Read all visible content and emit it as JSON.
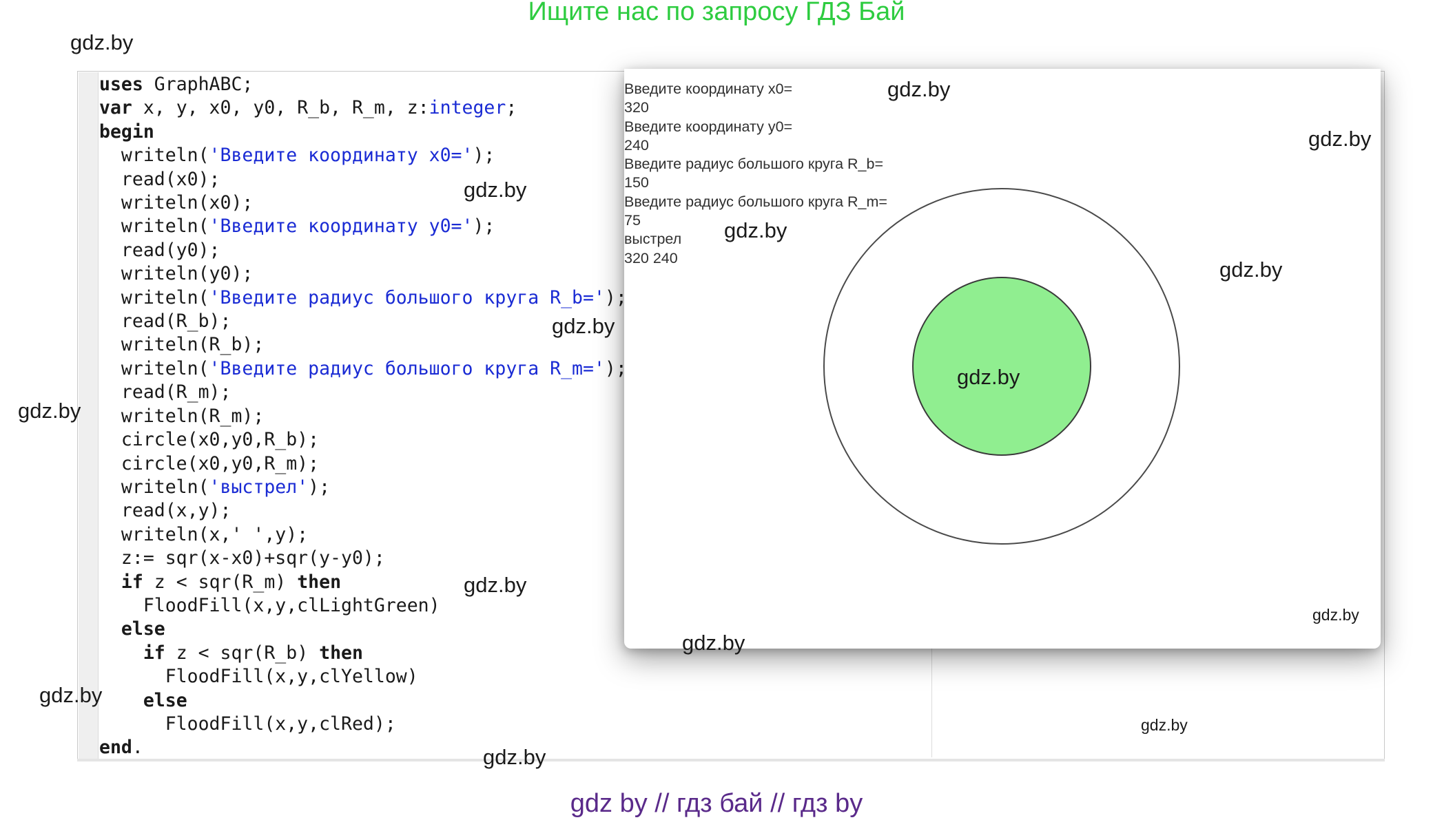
{
  "banner": {
    "top": "Ищите нас по запросу ГДЗ Бай",
    "bottom": "gdz by  //  гдз бай  //  гдз by"
  },
  "watermark": "gdz.by",
  "editor": {
    "lines": [
      [
        [
          "kw",
          "uses"
        ],
        [
          "t",
          " GraphABC;"
        ]
      ],
      [
        [
          "kw",
          "var"
        ],
        [
          "t",
          " x, y, x0, y0, R_b, R_m, z:"
        ],
        [
          "typ",
          "integer"
        ],
        [
          "t",
          ";"
        ]
      ],
      [
        [
          "kw",
          "begin"
        ]
      ],
      [
        [
          "t",
          "  writeln("
        ],
        [
          "str",
          "'Введите координату x0='"
        ],
        [
          "t",
          ");"
        ]
      ],
      [
        [
          "t",
          "  read(x0);"
        ]
      ],
      [
        [
          "t",
          "  writeln(x0);"
        ]
      ],
      [
        [
          "t",
          "  writeln("
        ],
        [
          "str",
          "'Введите координату y0='"
        ],
        [
          "t",
          ");"
        ]
      ],
      [
        [
          "t",
          "  read(y0);"
        ]
      ],
      [
        [
          "t",
          "  writeln(y0);"
        ]
      ],
      [
        [
          "t",
          "  writeln("
        ],
        [
          "str",
          "'Введите радиус большого круга R_b='"
        ],
        [
          "t",
          ");"
        ]
      ],
      [
        [
          "t",
          "  read(R_b);"
        ]
      ],
      [
        [
          "t",
          "  writeln(R_b);"
        ]
      ],
      [
        [
          "t",
          "  writeln("
        ],
        [
          "str",
          "'Введите радиус большого круга R_m='"
        ],
        [
          "t",
          ");"
        ]
      ],
      [
        [
          "t",
          "  read(R_m);"
        ]
      ],
      [
        [
          "t",
          "  writeln(R_m);"
        ]
      ],
      [
        [
          "t",
          "  circle(x0,y0,R_b);"
        ]
      ],
      [
        [
          "t",
          "  circle(x0,y0,R_m);"
        ]
      ],
      [
        [
          "t",
          "  writeln("
        ],
        [
          "str",
          "'выстрел'"
        ],
        [
          "t",
          ");"
        ]
      ],
      [
        [
          "t",
          "  read(x,y);"
        ]
      ],
      [
        [
          "t",
          "  writeln(x,' ',y);"
        ]
      ],
      [
        [
          "t",
          "  z:= sqr(x-x0)+sqr(y-y0);"
        ]
      ],
      [
        [
          "t",
          "  "
        ],
        [
          "kw",
          "if"
        ],
        [
          "t",
          " z < sqr(R_m) "
        ],
        [
          "kw",
          "then"
        ]
      ],
      [
        [
          "t",
          "    FloodFill(x,y,clLightGreen)"
        ]
      ],
      [
        [
          "t",
          "  "
        ],
        [
          "kw",
          "else"
        ]
      ],
      [
        [
          "t",
          "    "
        ],
        [
          "kw",
          "if"
        ],
        [
          "t",
          " z < sqr(R_b) "
        ],
        [
          "kw",
          "then"
        ]
      ],
      [
        [
          "t",
          "      FloodFill(x,y,clYellow)"
        ]
      ],
      [
        [
          "t",
          "    "
        ],
        [
          "kw",
          "else"
        ]
      ],
      [
        [
          "t",
          "      FloodFill(x,y,clRed);"
        ]
      ],
      [
        [
          "kw",
          "end"
        ],
        [
          "t",
          "."
        ]
      ]
    ]
  },
  "console": {
    "lines": [
      "Введите координату x0=",
      "320",
      "Введите координату y0=",
      "240",
      "Введите радиус большого круга R_b=",
      "150",
      "Введите радиус большого круга R_m=",
      "75",
      "выстрел",
      "320 240"
    ]
  },
  "graph": {
    "outer_circle_fill": "#ffffff",
    "outer_circle_stroke": "#4a4a4a",
    "inner_circle_fill": "#90ee90",
    "inner_circle_stroke": "#3a3a3a"
  },
  "colors": {
    "keyword": "#1a1a1a",
    "string": "#1a2bd4",
    "banner_top": "#2ecc40",
    "banner_bottom": "#5a2a8a"
  }
}
